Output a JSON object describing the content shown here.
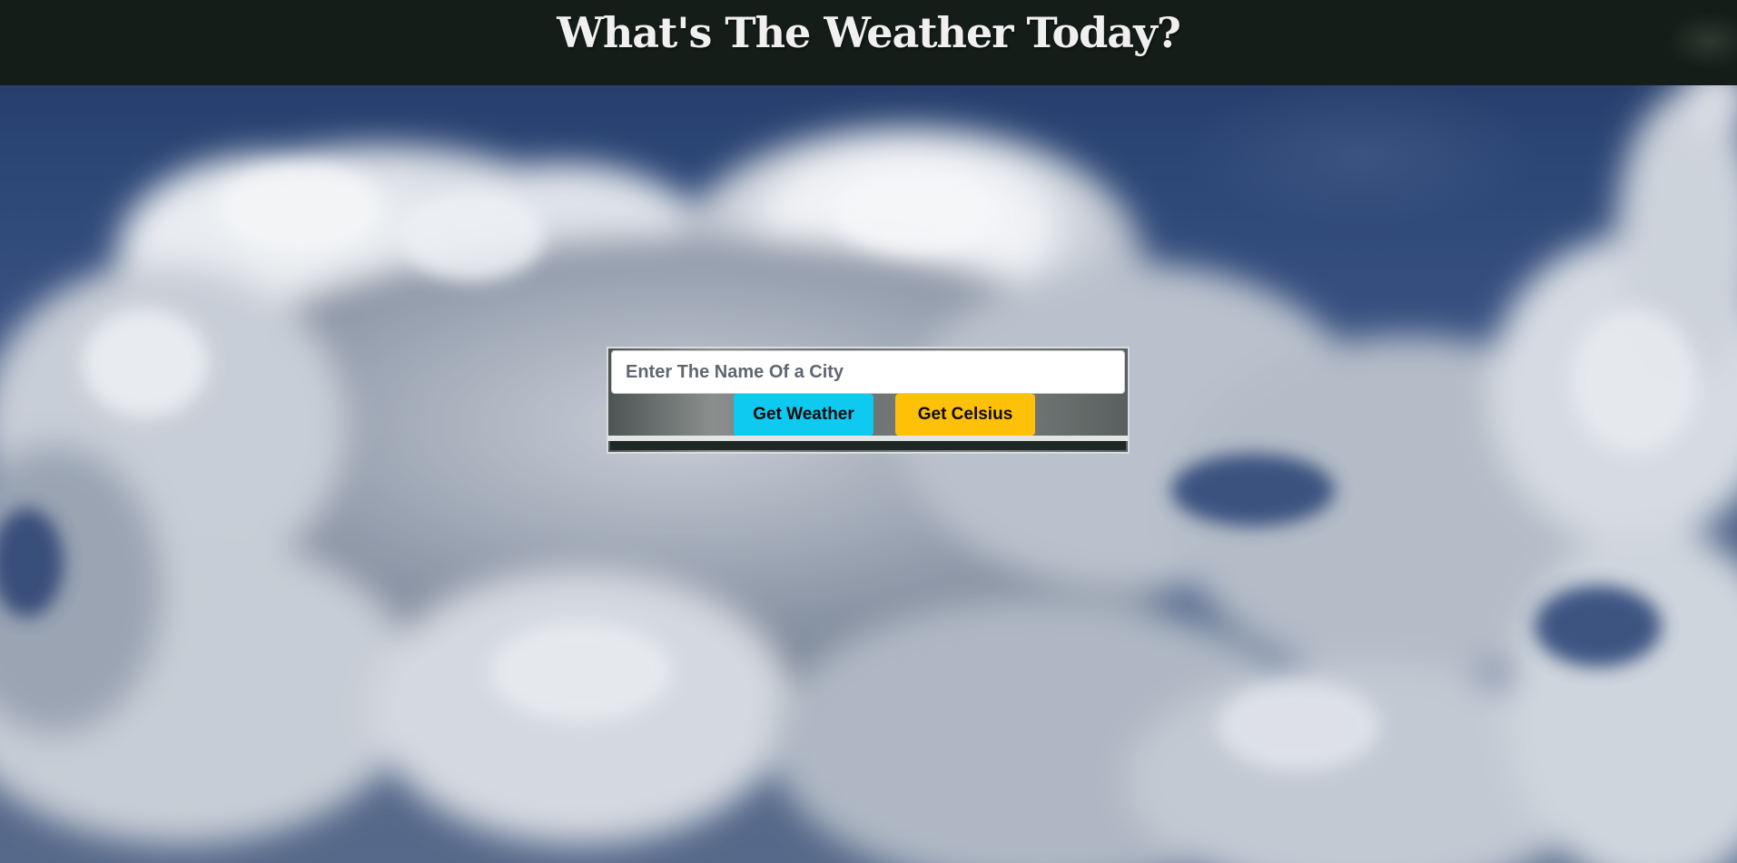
{
  "header": {
    "title": "What's The Weather Today?"
  },
  "search": {
    "placeholder": "Enter The Name Of a City",
    "value": ""
  },
  "buttons": {
    "get_weather_label": "Get Weather",
    "get_celsius_label": "Get Celsius"
  },
  "colors": {
    "header_bg": "#141d18",
    "weather_button": "#0fcaf0",
    "celsius_button": "#ffc107",
    "sky": "#2b4270"
  },
  "background": {
    "image": "sky-with-clouds"
  }
}
